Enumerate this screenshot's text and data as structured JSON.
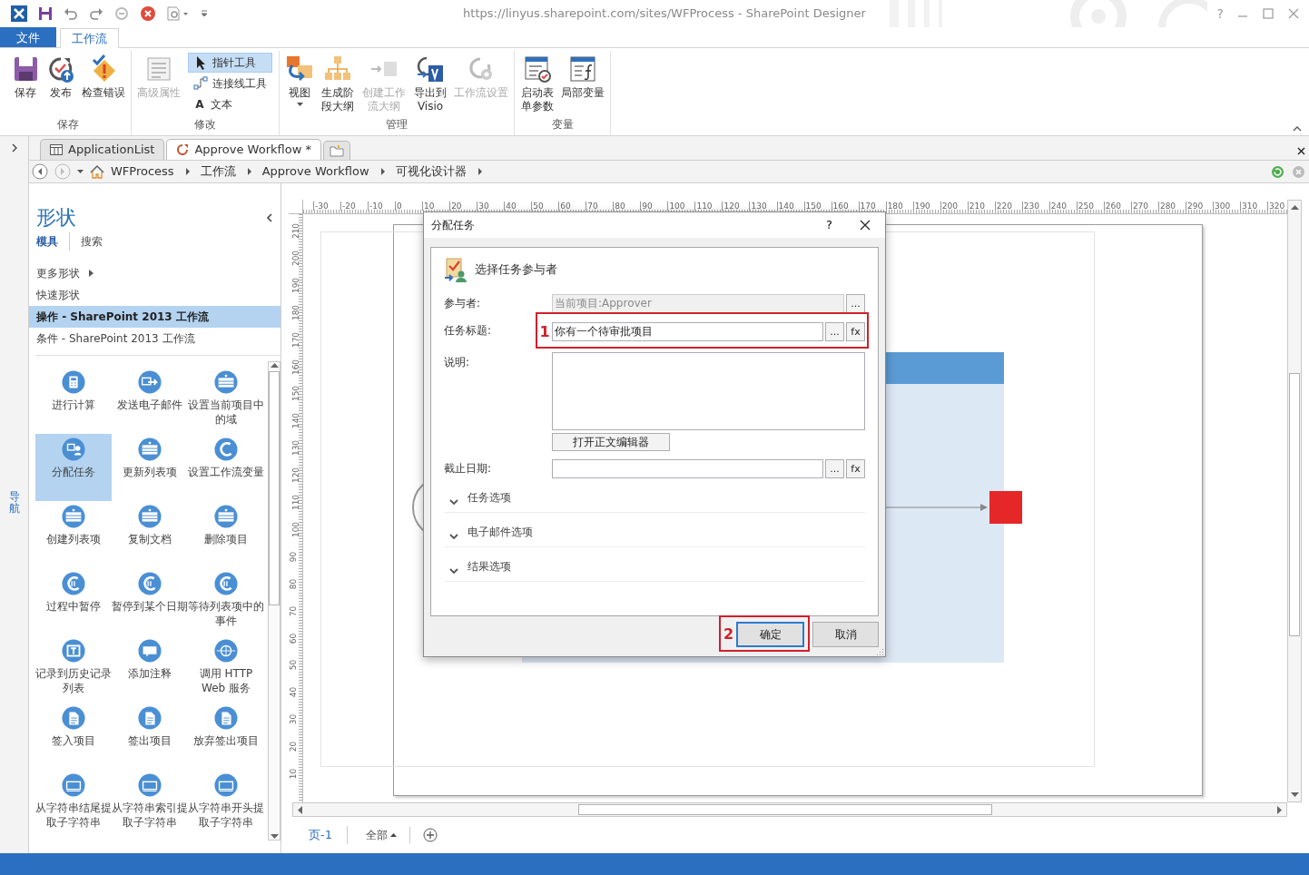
{
  "title_bar": {
    "title": "https://linyus.sharepoint.com/sites/WFProcess - SharePoint Designer",
    "help": "?"
  },
  "ribbon": {
    "tabs": [
      {
        "label": "文件",
        "kind": "backstage",
        "selected": false
      },
      {
        "label": "工作流",
        "kind": "tab",
        "selected": true
      }
    ],
    "groups": [
      {
        "label": "保存",
        "buttons": [
          {
            "kind": "large",
            "label": "保存",
            "disabled": false
          },
          {
            "kind": "large",
            "label": "发布",
            "disabled": false
          },
          {
            "kind": "large",
            "label": "检查错误",
            "disabled": false
          }
        ]
      },
      {
        "label": "修改",
        "buttons": [
          {
            "kind": "large",
            "label": "高级属性",
            "disabled": true
          },
          {
            "kind": "small",
            "label": "指针工具",
            "selected": true
          },
          {
            "kind": "small",
            "label": "连接线工具",
            "selected": false
          },
          {
            "kind": "small",
            "label": "文本",
            "glyph": "A",
            "selected": false
          }
        ]
      },
      {
        "label": "管理",
        "buttons": [
          {
            "kind": "large",
            "label": "视图",
            "disabled": false,
            "dropdown": true
          },
          {
            "kind": "large",
            "label": "生成阶段大纲",
            "disabled": false
          },
          {
            "kind": "large",
            "label": "创建工作流大纲",
            "disabled": true
          },
          {
            "kind": "large",
            "label": "导出到 Visio",
            "disabled": false
          },
          {
            "kind": "large",
            "label": "工作流设置",
            "disabled": true
          }
        ]
      },
      {
        "label": "变量",
        "buttons": [
          {
            "kind": "large",
            "label": "启动表单参数",
            "disabled": false
          },
          {
            "kind": "large",
            "label": "局部变量",
            "disabled": false
          }
        ]
      }
    ]
  },
  "doc_tabs": [
    {
      "label": "ApplicationList",
      "selected": false
    },
    {
      "label": "Approve Workflow *",
      "selected": true
    }
  ],
  "breadcrumb": [
    "WFProcess",
    "工作流",
    "Approve Workflow",
    "可视化设计器"
  ],
  "nav_pane": {
    "label": "导航"
  },
  "shapes_panel": {
    "title": "形状",
    "tabs": [
      {
        "label": "模具",
        "selected": true
      },
      {
        "label": "搜索",
        "selected": false
      }
    ],
    "links": [
      {
        "label": "更多形状",
        "kind": "submenu"
      },
      {
        "label": "快速形状",
        "kind": "plain"
      }
    ],
    "stencils": [
      {
        "label": "操作 - SharePoint 2013 工作流",
        "selected": true
      },
      {
        "label": "条件 - SharePoint 2013 工作流",
        "selected": false
      }
    ],
    "shapes": [
      {
        "label": "进行计算",
        "selected": false
      },
      {
        "label": "发送电子邮件",
        "selected": false
      },
      {
        "label": "设置当前项目中的域",
        "selected": false
      },
      {
        "label": "分配任务",
        "selected": true
      },
      {
        "label": "更新列表项",
        "selected": false
      },
      {
        "label": "设置工作流变量",
        "selected": false
      },
      {
        "label": "创建列表项",
        "selected": false
      },
      {
        "label": "复制文档",
        "selected": false
      },
      {
        "label": "删除项目",
        "selected": false
      },
      {
        "label": "过程中暂停",
        "selected": false
      },
      {
        "label": "暂停到某个日期",
        "selected": false
      },
      {
        "label": "等待列表项中的事件",
        "selected": false
      },
      {
        "label": "记录到历史记录列表",
        "selected": false
      },
      {
        "label": "添加注释",
        "selected": false
      },
      {
        "label": "调用 HTTP Web 服务",
        "selected": false
      },
      {
        "label": "签入项目",
        "selected": false
      },
      {
        "label": "签出项目",
        "selected": false
      },
      {
        "label": "放弃签出项目",
        "selected": false
      },
      {
        "label": "从字符串结尾提取子字符串",
        "selected": false
      },
      {
        "label": "从字符串索引提取子字符串",
        "selected": false
      },
      {
        "label": "从字符串开头提取子字符串",
        "selected": false
      }
    ]
  },
  "canvas": {
    "ruler_h": [
      "-30",
      "-20",
      "-10",
      "0",
      "10",
      "20",
      "30",
      "40",
      "50",
      "60",
      "70",
      "80",
      "90",
      "100",
      "110",
      "120",
      "130",
      "140",
      "150",
      "160",
      "170",
      "180",
      "190",
      "200",
      "210",
      "220",
      "230",
      "240",
      "250",
      "260",
      "270",
      "280",
      "290",
      "300",
      "310",
      "320"
    ],
    "ruler_v": [
      "210",
      "200",
      "190",
      "180",
      "170",
      "160",
      "150",
      "140",
      "130",
      "120",
      "110",
      "100",
      "90",
      "80",
      "70",
      "60",
      "50",
      "40",
      "30",
      "20",
      "10"
    ],
    "page_tabs": [
      {
        "label": "页-1",
        "selected": true
      }
    ],
    "all_pages": "全部"
  },
  "dialog": {
    "title": "分配任务",
    "help": "?",
    "heading": "选择任务参与者",
    "fields": [
      {
        "label": "参与者:",
        "kind": "readonly",
        "value": "当前项目:Approver",
        "buttons": [
          "..."
        ]
      },
      {
        "label": "任务标题:",
        "kind": "text",
        "value": "你有一个待审批项目",
        "buttons": [
          "...",
          "fx"
        ],
        "annotation": "1"
      },
      {
        "label": "说明:",
        "kind": "textarea",
        "button": "打开正文编辑器"
      },
      {
        "label": "截止日期:",
        "kind": "text",
        "buttons": [
          "...",
          "fx"
        ]
      }
    ],
    "sections": [
      {
        "label": "任务选项",
        "expanded": false
      },
      {
        "label": "电子邮件选项",
        "expanded": false
      },
      {
        "label": "结果选项",
        "expanded": false
      }
    ],
    "ok": {
      "label": "确定",
      "annotation": "2"
    },
    "cancel": "取消"
  }
}
